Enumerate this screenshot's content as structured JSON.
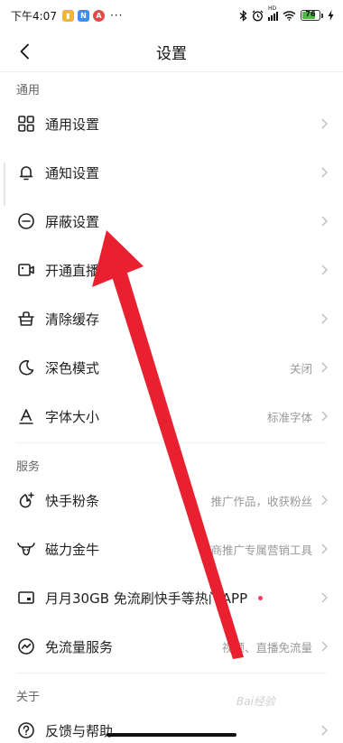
{
  "status_bar": {
    "time": "下午4:07",
    "badges": [
      {
        "icon": "notification-app-icon-yellow",
        "color": "#f1b53a"
      },
      {
        "icon": "notification-app-icon-n",
        "text": "N",
        "color": "#3a8ef1"
      },
      {
        "icon": "notification-app-icon-red",
        "text": "A",
        "color": "#e34b4b"
      }
    ],
    "dots": "···",
    "signal_label": "HD",
    "battery_level": "76",
    "battery_color": "#4cbb3f"
  },
  "nav": {
    "title": "设置"
  },
  "sections": {
    "general": {
      "header": "通用",
      "items": [
        {
          "label": "通用设置",
          "value": "",
          "icon": "grid-icon"
        },
        {
          "label": "通知设置",
          "value": "",
          "icon": "bell-icon"
        },
        {
          "label": "屏蔽设置",
          "value": "",
          "icon": "minus-circle-icon"
        },
        {
          "label": "开通直播",
          "value": "",
          "icon": "video-camera-icon"
        },
        {
          "label": "清除缓存",
          "value": "",
          "icon": "basket-icon"
        },
        {
          "label": "深色模式",
          "value": "关闭",
          "icon": "moon-icon"
        },
        {
          "label": "字体大小",
          "value": "标准字体",
          "icon": "font-a-icon"
        }
      ]
    },
    "services": {
      "header": "服务",
      "items": [
        {
          "label": "快手粉条",
          "value": "推广作品，收获粉丝",
          "icon": "fire-plus-icon"
        },
        {
          "label": "磁力金牛",
          "value": "电商推广专属营销工具",
          "icon": "bull-icon"
        },
        {
          "label": "月月30GB 免流刷快手等热门APP",
          "value": "",
          "icon": "sim-card-icon",
          "red_dot": true
        },
        {
          "label": "免流量服务",
          "value": "视频、直播免流量",
          "icon": "data-wave-icon"
        }
      ]
    },
    "about": {
      "header": "关于",
      "items": [
        {
          "label": "反馈与帮助",
          "value": "",
          "icon": "help-circle-icon"
        }
      ]
    }
  },
  "watermark": "Bai经验",
  "accent_red": "#e8202f",
  "red_dot_color": "#ff3b5c"
}
